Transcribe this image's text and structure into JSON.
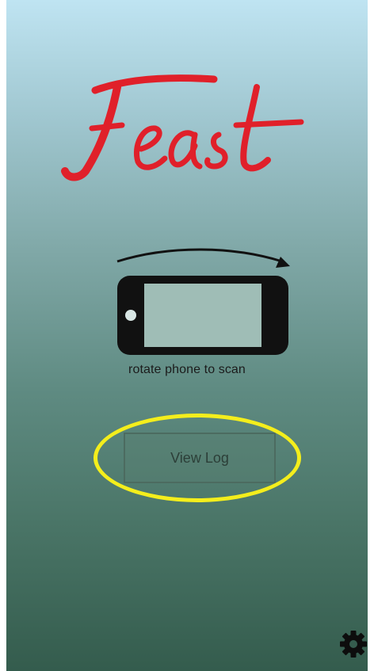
{
  "app": {
    "logo_text": "Feast",
    "logo_color": "#e0202a"
  },
  "scan": {
    "caption": "rotate phone to scan",
    "graphic": "rotate-phone-icon"
  },
  "actions": {
    "view_log_label": "View Log"
  },
  "toolbar": {
    "settings_icon": "gear-icon"
  },
  "annotation": {
    "highlight_color": "#f4ee1c",
    "highlight_target": "view-log-button"
  }
}
